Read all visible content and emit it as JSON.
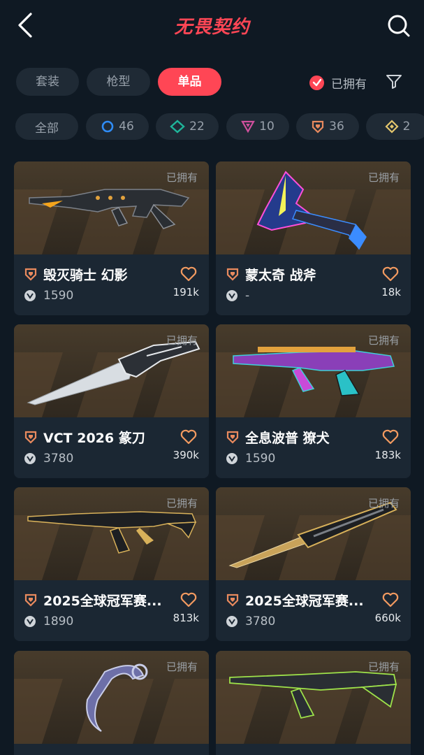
{
  "header": {
    "title": "无畏契约",
    "back_icon": "chevron-left-icon",
    "search_icon": "search-icon"
  },
  "tabs": [
    {
      "label": "套装",
      "active": false
    },
    {
      "label": "枪型",
      "active": false
    },
    {
      "label": "单品",
      "active": true
    }
  ],
  "owned_filter": {
    "label": "已拥有",
    "checked": true
  },
  "rarity_chips": [
    {
      "label": "全部",
      "icon": ""
    },
    {
      "label": "46",
      "icon": "select-tier-icon",
      "color": "#2f8cf5"
    },
    {
      "label": "22",
      "icon": "deluxe-tier-icon",
      "color": "#1fb59a"
    },
    {
      "label": "10",
      "icon": "premium-tier-icon",
      "color": "#d0509d"
    },
    {
      "label": "36",
      "icon": "exclusive-tier-icon",
      "color": "#e98a5e"
    },
    {
      "label": "2",
      "icon": "ultra-tier-icon",
      "color": "#e3c66d"
    }
  ],
  "colors": {
    "accent": "#ff4655",
    "background": "#0f1923",
    "card": "#1b2733",
    "tier_exclusive": "#e98a5e",
    "heart": "#f29a60"
  },
  "cards": [
    {
      "owned_tag": "已拥有",
      "name": "毁灭骑士 幻影",
      "price": "1590",
      "likes": "191k",
      "weapon": "rifle"
    },
    {
      "owned_tag": "已拥有",
      "name": "蒙太奇 战斧",
      "price": "-",
      "likes": "18k",
      "weapon": "axe"
    },
    {
      "owned_tag": "已拥有",
      "name": "VCT 2026 篆刀",
      "price": "3780",
      "likes": "390k",
      "weapon": "knife"
    },
    {
      "owned_tag": "已拥有",
      "name": "全息波普 獠犬",
      "price": "1590",
      "likes": "183k",
      "weapon": "smg"
    },
    {
      "owned_tag": "已拥有",
      "name": "2025全球冠军赛...",
      "price": "1890",
      "likes": "813k",
      "weapon": "rifle-gold"
    },
    {
      "owned_tag": "已拥有",
      "name": "2025全球冠军赛...",
      "price": "3780",
      "likes": "660k",
      "weapon": "dagger"
    },
    {
      "owned_tag": "已拥有",
      "name": "",
      "price": "",
      "likes": "",
      "weapon": "karambit"
    },
    {
      "owned_tag": "已拥有",
      "name": "",
      "price": "",
      "likes": "",
      "weapon": "rifle-green"
    }
  ]
}
